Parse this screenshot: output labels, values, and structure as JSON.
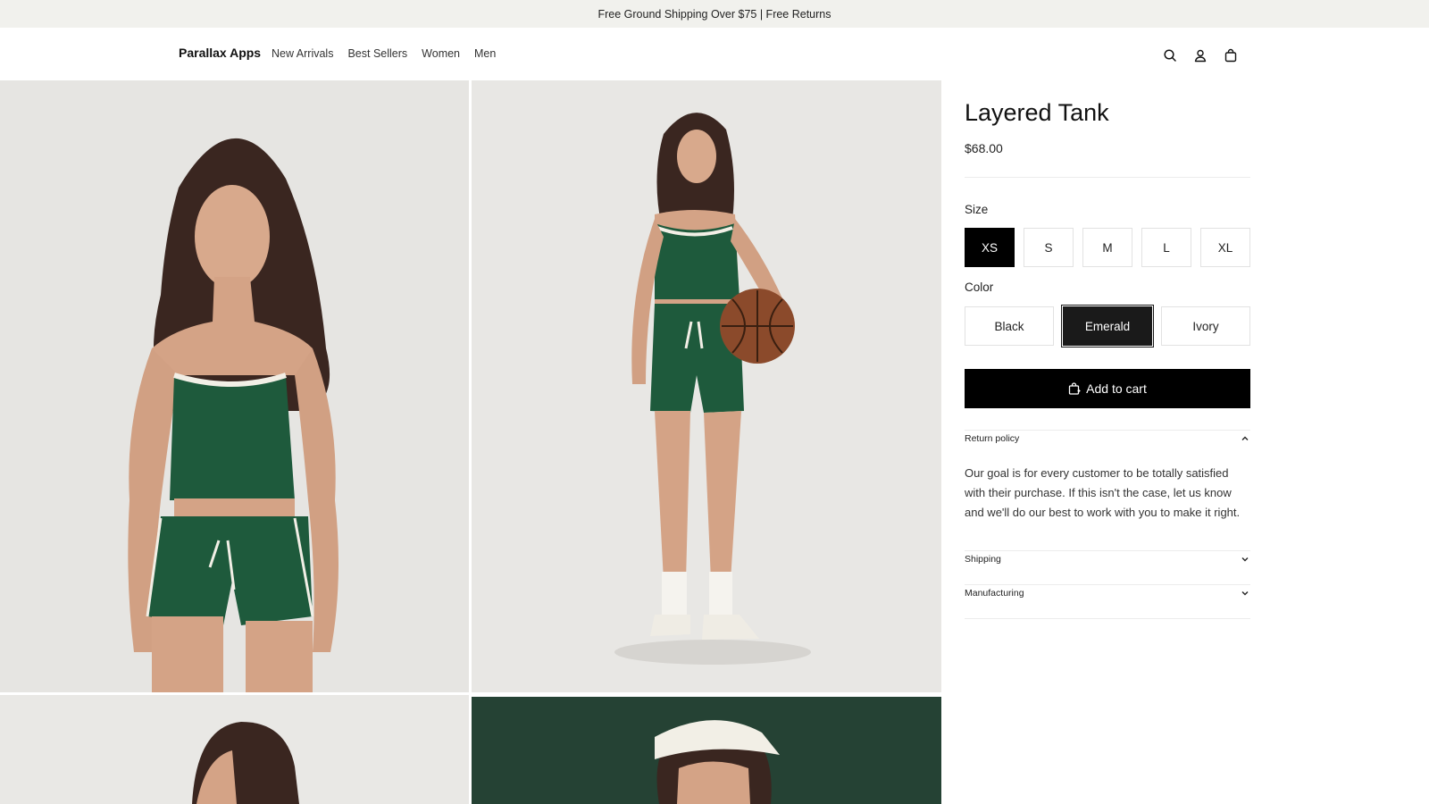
{
  "announcement": "Free Ground Shipping Over $75 | Free Returns",
  "header": {
    "brand": "Parallax Apps",
    "nav": [
      "New Arrivals",
      "Best Sellers",
      "Women",
      "Men"
    ],
    "icons": [
      "search-icon",
      "account-icon",
      "bag-icon"
    ]
  },
  "gallery": {
    "images": [
      "model-front-emerald-set",
      "model-full-body-basketball",
      "model-back-view",
      "model-visor-closeup"
    ]
  },
  "product": {
    "title": "Layered Tank",
    "price": "$68.00",
    "size_label": "Size",
    "sizes": [
      "XS",
      "S",
      "M",
      "L",
      "XL"
    ],
    "selected_size": "XS",
    "color_label": "Color",
    "colors": [
      "Black",
      "Emerald",
      "Ivory"
    ],
    "selected_color": "Emerald",
    "add_to_cart": "Add to cart"
  },
  "accordion": [
    {
      "title": "Return policy",
      "expanded": true,
      "body": "Our goal is for every customer to be totally satisfied with their purchase. If this isn't the case, let us know and we'll do our best to work with you to make it right."
    },
    {
      "title": "Shipping",
      "expanded": false
    },
    {
      "title": "Manufacturing",
      "expanded": false
    }
  ],
  "colors": {
    "announcement_bg": "#f1f1ed",
    "primary": "#000000",
    "emerald": "#1e5a3c"
  }
}
